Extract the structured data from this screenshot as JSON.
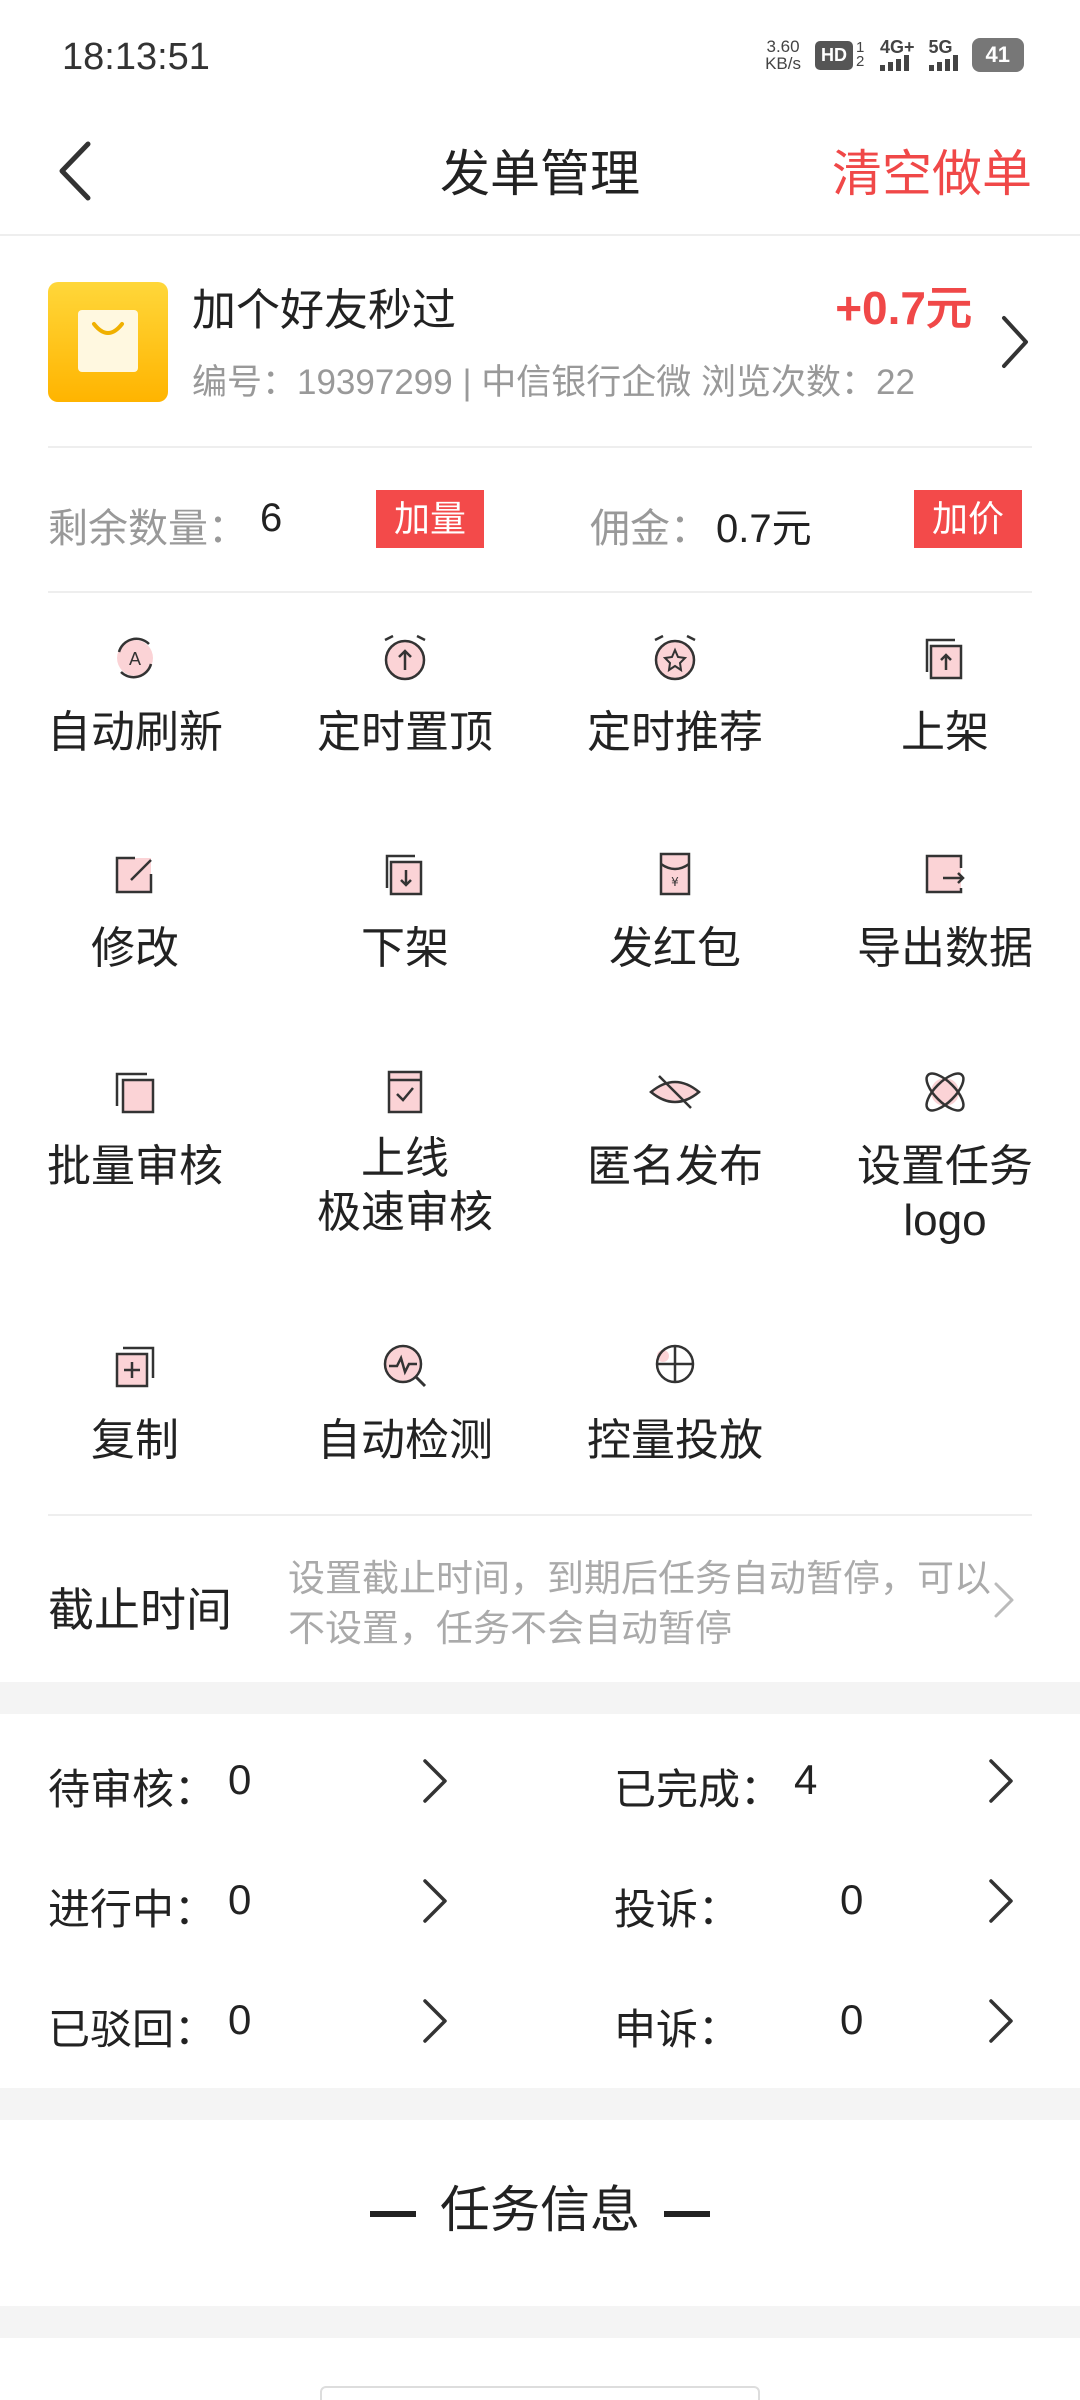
{
  "status_bar": {
    "time": "18:13:51",
    "net_speed": "3.60",
    "net_unit": "KB/s",
    "hd": "HD",
    "hd_sub": "1 2",
    "sig1": "4G+",
    "sig2": "5G",
    "battery": "41"
  },
  "header": {
    "title": "发单管理",
    "clear_label": "清空做单",
    "back_icon": "chevron-left-icon"
  },
  "task": {
    "title": "加个好友秒过",
    "meta": "编号：19397299 | 中信银行企微  浏览次数：22",
    "price": "+0.7元",
    "logo_icon": "shopping-bag-icon"
  },
  "quantity": {
    "remaining_label": "剩余数量：",
    "remaining_value": "6",
    "add_qty_label": "加量",
    "commission_label": "佣金：",
    "commission_value": "0.7元",
    "add_price_label": "加价"
  },
  "actions": [
    {
      "label": "自动刷新",
      "icon": "auto-refresh-icon"
    },
    {
      "label": "定时置顶",
      "icon": "alarm-top-icon"
    },
    {
      "label": "定时推荐",
      "icon": "alarm-star-icon"
    },
    {
      "label": "上架",
      "icon": "shelf-up-icon"
    },
    {
      "label": "修改",
      "icon": "edit-icon"
    },
    {
      "label": "下架",
      "icon": "shelf-down-icon"
    },
    {
      "label": "发红包",
      "icon": "red-packet-icon"
    },
    {
      "label": "导出数据",
      "icon": "export-icon"
    },
    {
      "label": "批量审核",
      "icon": "batch-review-icon"
    },
    {
      "label": "上线\n极速审核",
      "icon": "fast-review-icon"
    },
    {
      "label": "匿名发布",
      "icon": "eye-off-icon"
    },
    {
      "label": "设置任务\nlogo",
      "icon": "atom-logo-icon"
    },
    {
      "label": "复制",
      "icon": "copy-icon"
    },
    {
      "label": "自动检测",
      "icon": "auto-detect-icon"
    },
    {
      "label": "控量投放",
      "icon": "crosshair-icon"
    }
  ],
  "deadline": {
    "label": "截止时间",
    "hint": "设置截止时间，到期后任务自动暂停，可以不设置，任务不会自动暂停"
  },
  "stats": {
    "pending_label": "待审核：",
    "pending_value": "0",
    "completed_label": "已完成：",
    "completed_value": "4",
    "in_progress_label": "进行中：",
    "in_progress_value": "0",
    "complaint_label": "投诉：",
    "complaint_value": "0",
    "rejected_label": "已驳回：",
    "rejected_value": "0",
    "appeal_label": "申诉：",
    "appeal_value": "0"
  },
  "task_info": {
    "heading": "任务信息"
  },
  "colors": {
    "accent_red": "#f04848",
    "icon_pink": "#fbd3d6",
    "icon_stroke": "#333333"
  }
}
